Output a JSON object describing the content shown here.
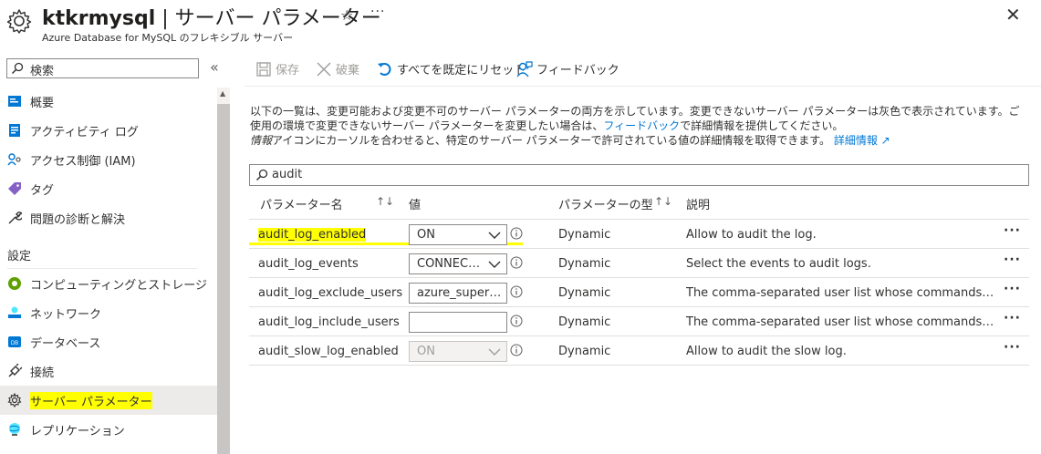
{
  "header": {
    "title_name": "ktkrmysql",
    "title_rest": " | サーバー パラメーター",
    "subtitle": "Azure Database for MySQL のフレキシブル サーバー"
  },
  "sidebar": {
    "search_placeholder": "検索",
    "items": [
      {
        "label": "概要",
        "icon": "overview-icon"
      },
      {
        "label": "アクティビティ ログ",
        "icon": "activity-log-icon"
      },
      {
        "label": "アクセス制御 (IAM)",
        "icon": "iam-icon"
      },
      {
        "label": "タグ",
        "icon": "tag-icon"
      },
      {
        "label": "問題の診断と解決",
        "icon": "wrench-icon"
      }
    ],
    "section_settings": "設定",
    "settings_items": [
      {
        "label": "コンピューティングとストレージ",
        "icon": "compute-icon"
      },
      {
        "label": "ネットワーク",
        "icon": "network-icon"
      },
      {
        "label": "データベース",
        "icon": "database-icon"
      },
      {
        "label": "接続",
        "icon": "plug-icon"
      },
      {
        "label": "サーバー パラメーター",
        "icon": "gear-icon"
      },
      {
        "label": "レプリケーション",
        "icon": "globe-icon"
      }
    ]
  },
  "toolbar": {
    "save": "保存",
    "discard": "破棄",
    "reset": "すべてを既定にリセット",
    "feedback": "フィードバック"
  },
  "description": {
    "line1_a": "以下の一覧は、変更可能および変更不可のサーバー パラメーターの両方を示しています。変更できないサーバー パラメーターは灰色で表示されています。ご使用の環境で変更できないサーバー パラメーターを変更したい場合は、",
    "feedback_link": "フィードバック",
    "line1_b": "で詳細情報を提供してください。",
    "line2_italic": "情報",
    "line2_a": "アイコンにカーソルを合わせると、特定のサーバー パラメーターで許可されている値の詳細情報を取得できます。",
    "more_link": "詳細情報"
  },
  "filter": {
    "value": "audit"
  },
  "table": {
    "headers": {
      "name": "パラメーター名",
      "value": "値",
      "type": "パラメーターの型",
      "desc": "説明"
    },
    "rows": [
      {
        "name": "audit_log_enabled",
        "value": "ON",
        "kind": "select",
        "type": "Dynamic",
        "desc": "Allow to audit the log."
      },
      {
        "name": "audit_log_events",
        "value": "CONNECTION",
        "kind": "select",
        "type": "Dynamic",
        "desc": "Select the events to audit logs."
      },
      {
        "name": "audit_log_exclude_users",
        "value": "azure_superuser",
        "kind": "text",
        "type": "Dynamic",
        "desc": "The comma-separated user list whose commands will not be in the audit logs."
      },
      {
        "name": "audit_log_include_users",
        "value": "",
        "kind": "text",
        "type": "Dynamic",
        "desc": "The comma-separated user list whose commands will be in the audit logs."
      },
      {
        "name": "audit_slow_log_enabled",
        "value": "ON",
        "kind": "select-disabled",
        "type": "Dynamic",
        "desc": "Allow to audit the slow log."
      }
    ]
  }
}
